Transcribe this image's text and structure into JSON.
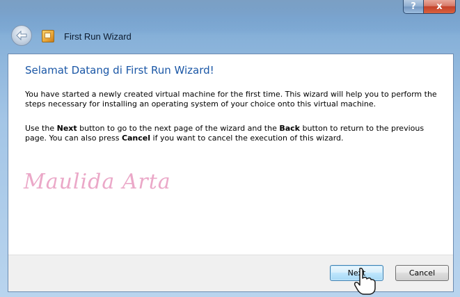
{
  "window": {
    "title": "First Run Wizard",
    "caption_buttons": {
      "help": "?",
      "close": "x"
    }
  },
  "content": {
    "heading": "Selamat Datang di First Run Wizard!",
    "paragraph1": "You have started a newly created virtual machine for the first time. This wizard will help you to perform the steps necessary for installing an operating system of your choice onto this virtual machine.",
    "paragraph2": {
      "part1": "Use the ",
      "next_word": "Next",
      "part2": " button to go to the next page of the wizard and the ",
      "back_word": "Back",
      "part3": " button to return to the previous page. You can also press ",
      "cancel_word": "Cancel",
      "part4": " if you want to cancel the execution of this wizard."
    },
    "watermark": "Maulida Arta"
  },
  "footer": {
    "next_label": "Next",
    "cancel_label": "Cancel"
  },
  "icons": {
    "back": "back-arrow-icon",
    "wizard": "wizard-app-icon",
    "cursor": "hand-cursor-icon"
  },
  "colors": {
    "heading": "#1b57a6",
    "watermark": "#eba8c8",
    "close_button": "#c4412a",
    "next_button_border": "#3c7fb1"
  }
}
